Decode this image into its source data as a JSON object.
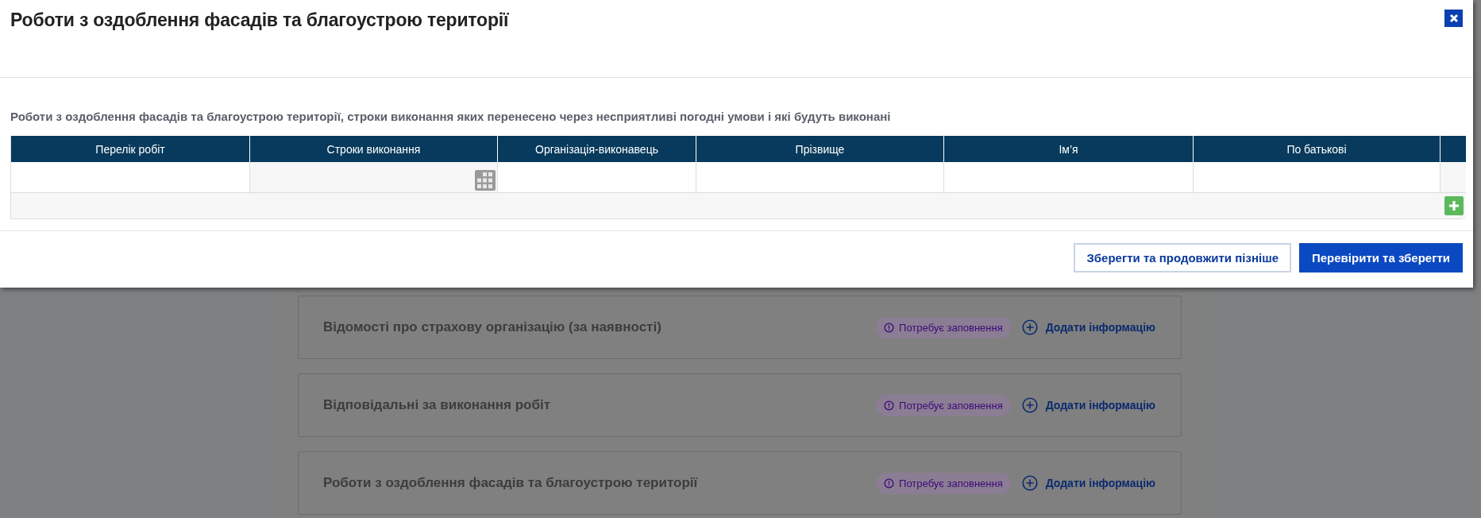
{
  "modal": {
    "title": "Роботи з оздоблення фасадів та благоустрою території",
    "section_title": "Роботи з оздоблення фасадів та благоустрою території, строки виконання яких перенесено через несприятливі погодні умови і які будуть виконані",
    "table": {
      "columns": [
        "Перелік робіт",
        "Строки виконання",
        "Організація-виконавець",
        "Прізвище",
        "Ім’я",
        "По батькові"
      ],
      "input_row": [
        {
          "kind": "text"
        },
        {
          "kind": "date"
        },
        {
          "kind": "text"
        },
        {
          "kind": "text"
        },
        {
          "kind": "text"
        },
        {
          "kind": "text"
        }
      ]
    },
    "buttons": [
      {
        "label": "Зберегти та продовжити пізніше",
        "kind": "secondary"
      },
      {
        "label": "Перевірити та зберегти",
        "kind": "primary"
      }
    ]
  },
  "background": {
    "sections": [
      {
        "title": "Відомості про страхову організацію (за наявності)",
        "status": "Потребує заповнення",
        "action": "Додати інформацію"
      },
      {
        "title": "Відповідальні за виконання робіт",
        "status": "Потребує заповнення",
        "action": "Додати інформацію"
      },
      {
        "title": "Роботи з оздоблення фасадів та благоустрою території",
        "status": "Потребує заповнення",
        "action": "Додати інформацію"
      }
    ]
  }
}
